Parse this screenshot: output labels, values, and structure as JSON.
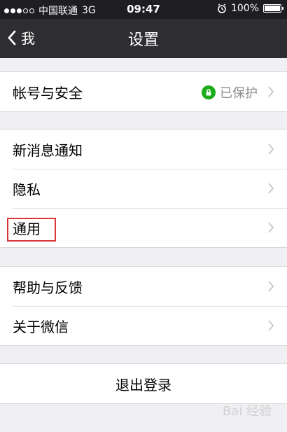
{
  "statusbar": {
    "carrier": "中国联通",
    "network": "3G",
    "time": "09:47",
    "battery_percent": 100,
    "battery_label": "100%"
  },
  "navbar": {
    "back_label": "我",
    "title": "设置"
  },
  "groups": [
    {
      "items": [
        {
          "label": "帐号与安全",
          "status": "已保护",
          "status_icon": "lock-icon"
        }
      ]
    },
    {
      "items": [
        {
          "label": "新消息通知"
        },
        {
          "label": "隐私"
        },
        {
          "label": "通用"
        }
      ]
    },
    {
      "items": [
        {
          "label": "帮助与反馈"
        },
        {
          "label": "关于微信"
        }
      ]
    }
  ],
  "logout_label": "退出登录",
  "watermark_text": "Bai 经验",
  "colors": {
    "accent_green": "#1aad19",
    "highlight_red": "#d9363a"
  }
}
